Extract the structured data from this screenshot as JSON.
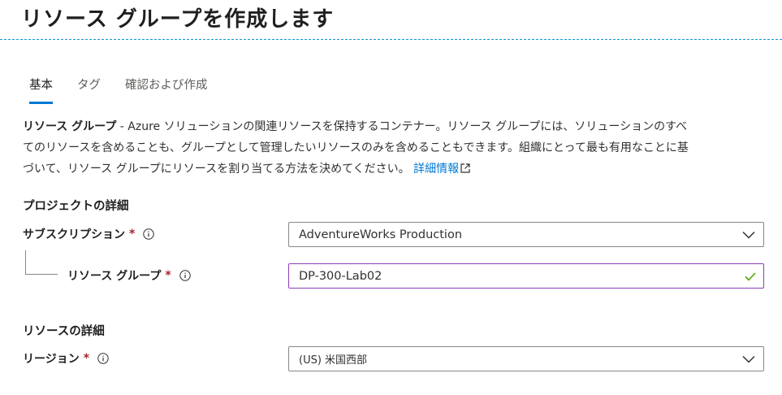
{
  "header": {
    "title": "リソース グループを作成します"
  },
  "tabs": [
    {
      "label": "基本",
      "active": true
    },
    {
      "label": "タグ",
      "active": false
    },
    {
      "label": "確認および作成",
      "active": false
    }
  ],
  "description": {
    "bold": "リソース グループ",
    "text": " - Azure ソリューションの関連リソースを保持するコンテナー。リソース グループには、ソリューションのすべてのリソースを含めることも、グループとして管理したいリソースのみを含めることもできます。組織にとって最も有用なことに基づいて、リソース グループにリソースを割り当てる方法を決めてください。 ",
    "link": "詳細情報"
  },
  "project": {
    "heading": "プロジェクトの詳細",
    "subscription": {
      "label": "サブスクリプション",
      "required": "*",
      "value": "AdventureWorks Production"
    },
    "resource_group": {
      "label": "リソース グループ",
      "required": "*",
      "value": "DP-300-Lab02"
    }
  },
  "resource": {
    "heading": "リソースの詳細",
    "region": {
      "label": "リージョン",
      "required": "*",
      "value": "(US) 米国西部"
    }
  },
  "colors": {
    "accent": "#0078d4",
    "required": "#a4262c",
    "valid_border": "#8b3dba",
    "valid_check": "#57a300",
    "divider": "#0e97d0"
  },
  "icons": [
    "info-icon",
    "chevron-down-icon",
    "checkmark-icon",
    "external-link-icon"
  ]
}
